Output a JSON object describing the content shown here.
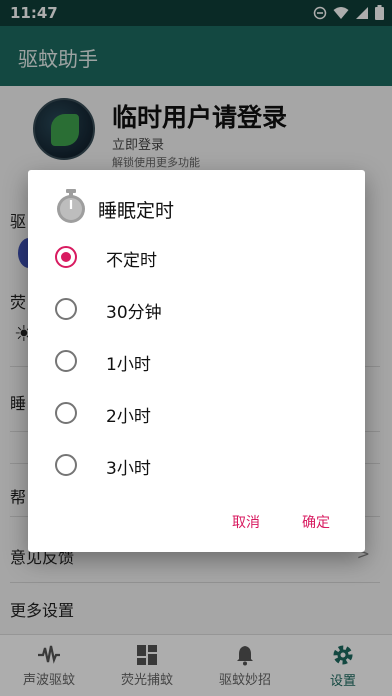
{
  "status_bar": {
    "time": "11:47"
  },
  "app_bar": {
    "title": "驱蚊助手"
  },
  "profile": {
    "name": "临时用户请登录",
    "login_link": "立即登录",
    "unlock_tip": "解锁使用更多功能"
  },
  "background_rows": {
    "row1": "驱",
    "row2": "荧",
    "row3": "睡",
    "row4": "帮",
    "feedback": "意见反馈",
    "more": "更多设置"
  },
  "dialog": {
    "title": "睡眠定时",
    "options": [
      {
        "label": "不定时",
        "checked": true
      },
      {
        "label": "30分钟",
        "checked": false
      },
      {
        "label": "1小时",
        "checked": false
      },
      {
        "label": "2小时",
        "checked": false
      },
      {
        "label": "3小时",
        "checked": false
      }
    ],
    "cancel_label": "取消",
    "confirm_label": "确定"
  },
  "bottom_nav": {
    "tabs": [
      {
        "label": "声波驱蚊",
        "icon": "waveform-icon",
        "active": false
      },
      {
        "label": "荧光捕蚊",
        "icon": "grid-icon",
        "active": false
      },
      {
        "label": "驱蚊妙招",
        "icon": "bell-icon",
        "active": false
      },
      {
        "label": "设置",
        "icon": "gear-icon",
        "active": true
      }
    ]
  },
  "colors": {
    "status_bar": "#0f3f38",
    "app_bar": "#1d6b60",
    "accent": "#d81b60",
    "active_tab": "#1d6b60"
  }
}
